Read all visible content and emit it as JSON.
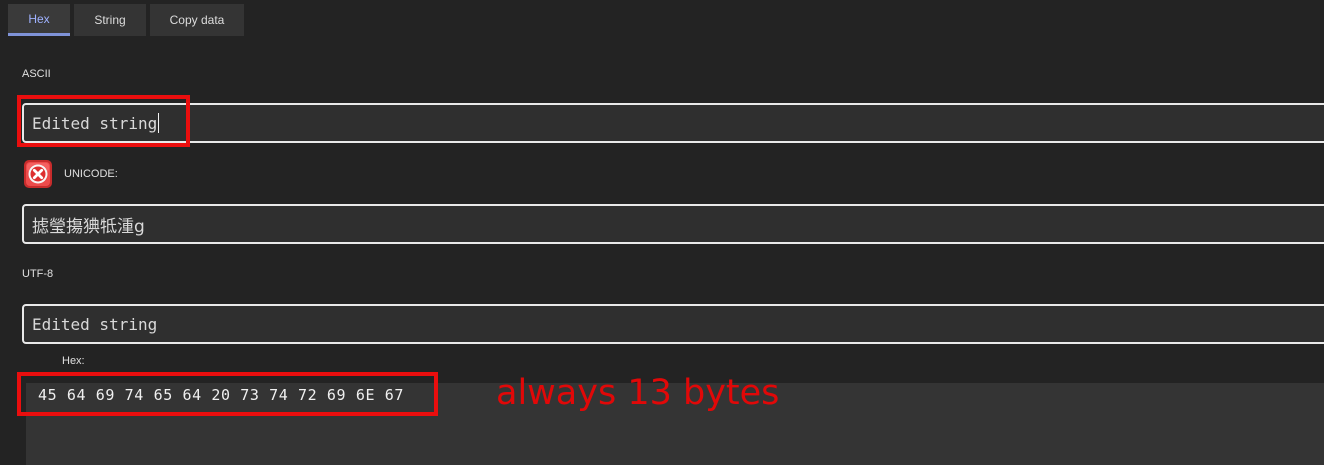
{
  "tabs": {
    "hex_label": "Hex",
    "string_label": "String",
    "copy_label": "Copy data",
    "active": "Hex"
  },
  "sections": {
    "ascii_label": "ASCII",
    "ascii_value": "Edited string",
    "unicode_label": "UNICODE:",
    "unicode_value": "摅瑩摥猠牴湩g",
    "utf8_label": "UTF-8",
    "utf8_value": "Edited string",
    "hex_label": "Hex:",
    "hex_value": "45 64 69 74 65 64 20 73 74 72 69 6E 67"
  },
  "annotations": {
    "note": "always 13 bytes",
    "highlight_color": "#ea0e0e"
  },
  "icons": {
    "unicode_status": "error-icon"
  },
  "colors": {
    "background": "#232323",
    "field_background": "#2f2f2f",
    "field_border": "#e9e9e9",
    "active_tab_text": "#9fb2ff",
    "active_tab_underline": "#7f93d8",
    "error_icon": "#e73b3b"
  }
}
